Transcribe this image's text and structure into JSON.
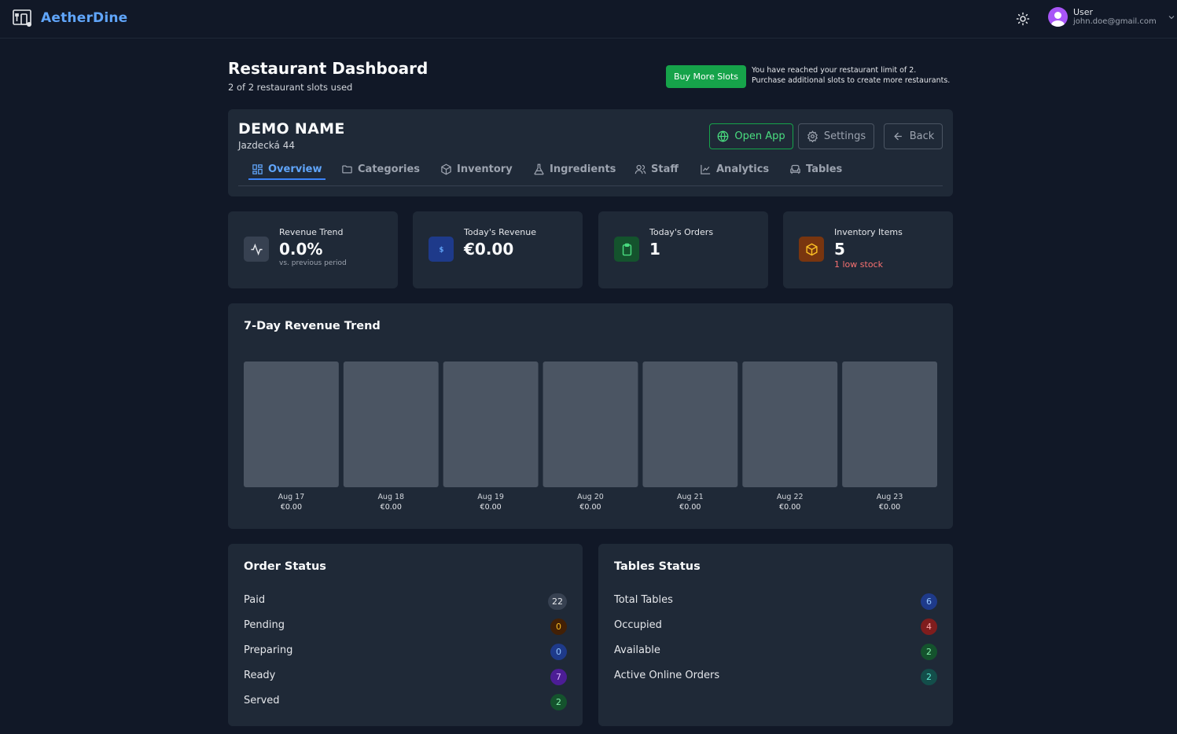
{
  "app": {
    "name": "AetherDine"
  },
  "user": {
    "name": "User",
    "email": "john.doe@gmail.com"
  },
  "header": {
    "title": "Restaurant Dashboard",
    "subtitle": "2 of 2 restaurant slots used",
    "buy_label": "Buy More Slots",
    "limit_line1": "You have reached your restaurant limit of 2.",
    "limit_line2": "Purchase additional slots to create more restaurants."
  },
  "restaurant": {
    "name": "DEMO NAME",
    "address": "Jazdecká 44",
    "open_label": "Open App",
    "settings_label": "Settings",
    "back_label": "Back"
  },
  "tabs": [
    {
      "label": "Overview",
      "icon": "layout-grid-icon",
      "active": true
    },
    {
      "label": "Categories",
      "icon": "folder-icon"
    },
    {
      "label": "Inventory",
      "icon": "package-icon"
    },
    {
      "label": "Ingredients",
      "icon": "flask-icon"
    },
    {
      "label": "Staff",
      "icon": "users-icon"
    },
    {
      "label": "Analytics",
      "icon": "line-chart-icon"
    },
    {
      "label": "Tables",
      "icon": "armchair-icon"
    }
  ],
  "stats": [
    {
      "label": "Revenue Trend",
      "value": "0.0%",
      "note": "vs. previous period",
      "icon": "activity-icon",
      "color": "#374151"
    },
    {
      "label": "Today's Revenue",
      "value": "€0.00",
      "note": "",
      "icon": "dollar-icon",
      "color": "#1e3a8a"
    },
    {
      "label": "Today's Orders",
      "value": "1",
      "note": "",
      "icon": "clipboard-icon",
      "color": "#14532d"
    },
    {
      "label": "Inventory Items",
      "value": "5",
      "note": "1 low stock",
      "icon": "box-icon",
      "color": "#78350f"
    }
  ],
  "chart_data": {
    "type": "bar",
    "title": "7-Day Revenue Trend",
    "categories": [
      "Aug 17",
      "Aug 18",
      "Aug 19",
      "Aug 20",
      "Aug 21",
      "Aug 22",
      "Aug 23"
    ],
    "values": [
      0,
      0,
      0,
      0,
      0,
      0,
      0
    ],
    "value_labels": [
      "€0.00",
      "€0.00",
      "€0.00",
      "€0.00",
      "€0.00",
      "€0.00",
      "€0.00"
    ],
    "bar_color": "#4b5563"
  },
  "order_status": {
    "title": "Order Status",
    "rows": [
      {
        "label": "Paid",
        "count": "22",
        "bg": "#374151",
        "fg": "#e5e7eb"
      },
      {
        "label": "Pending",
        "count": "0",
        "bg": "#422006",
        "fg": "#fbbf24"
      },
      {
        "label": "Preparing",
        "count": "0",
        "bg": "#1e3a8a",
        "fg": "#93c5fd"
      },
      {
        "label": "Ready",
        "count": "7",
        "bg": "#4c1d95",
        "fg": "#d8b4fe"
      },
      {
        "label": "Served",
        "count": "2",
        "bg": "#14532d",
        "fg": "#86efac"
      }
    ]
  },
  "tables_status": {
    "title": "Tables Status",
    "rows": [
      {
        "label": "Total Tables",
        "count": "6",
        "bg": "#1e3a8a",
        "fg": "#93c5fd"
      },
      {
        "label": "Occupied",
        "count": "4",
        "bg": "#7f1d1d",
        "fg": "#fca5a5"
      },
      {
        "label": "Available",
        "count": "2",
        "bg": "#14532d",
        "fg": "#86efac"
      },
      {
        "label": "Active Online Orders",
        "count": "2",
        "bg": "#134e4a",
        "fg": "#5eead4"
      }
    ]
  }
}
